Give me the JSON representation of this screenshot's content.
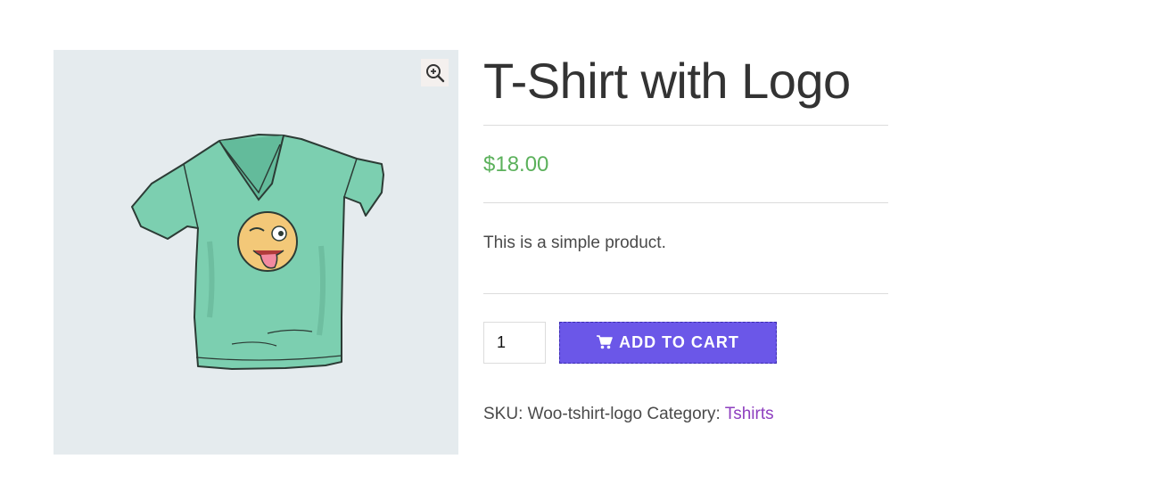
{
  "product": {
    "title": "T-Shirt with Logo",
    "price": "$18.00",
    "description": "This is a simple product.",
    "quantity": "1",
    "add_to_cart_label": "ADD TO CART",
    "sku_label": "SKU:",
    "sku_value": "Woo-tshirt-logo",
    "category_label": "Category:",
    "category_value": "Tshirts"
  },
  "icons": {
    "zoom": "zoom-in-icon",
    "cart": "cart-icon"
  },
  "colors": {
    "price": "#5cb15c",
    "button": "#6b57e8",
    "category_link": "#8e3fbf",
    "gallery_bg": "#e5ebee"
  }
}
